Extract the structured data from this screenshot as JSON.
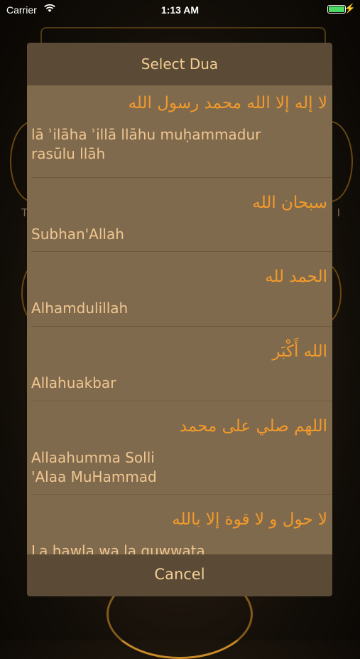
{
  "status_bar": {
    "carrier": "Carrier",
    "time": "1:13 AM",
    "battery_percent": 100
  },
  "colors": {
    "accent": "#f29a2a",
    "text": "#efc690",
    "sheet": "#806a4e",
    "header": "#5a4a36"
  },
  "background_letters": {
    "left": "T",
    "right": "I"
  },
  "dua_sheet": {
    "title": "Select Dua",
    "cancel_label": "Cancel",
    "items": [
      {
        "arabic": "لا إله إلا الله محمد رسول الله",
        "translit_line1": "lā ʾilāha ʾillā llāhu muḥammadur",
        "translit_line2": "rasūlu llāh"
      },
      {
        "arabic": "سبحان الله",
        "translit_line1": "Subhan'Allah",
        "translit_line2": ""
      },
      {
        "arabic": "الحمد لله",
        "translit_line1": "Alhamdulillah",
        "translit_line2": ""
      },
      {
        "arabic": "الله أَكْبَر",
        "translit_line1": "Allahuakbar",
        "translit_line2": ""
      },
      {
        "arabic": "اللهم صلي على محمد",
        "translit_line1": "Allaahumma Solli",
        "translit_line2": "'Alaa MuHammad"
      },
      {
        "arabic": "لا حول و لا قوة إلا بالله",
        "translit_line1": "La hawla wa la quwwata",
        "translit_line2": ""
      }
    ]
  }
}
